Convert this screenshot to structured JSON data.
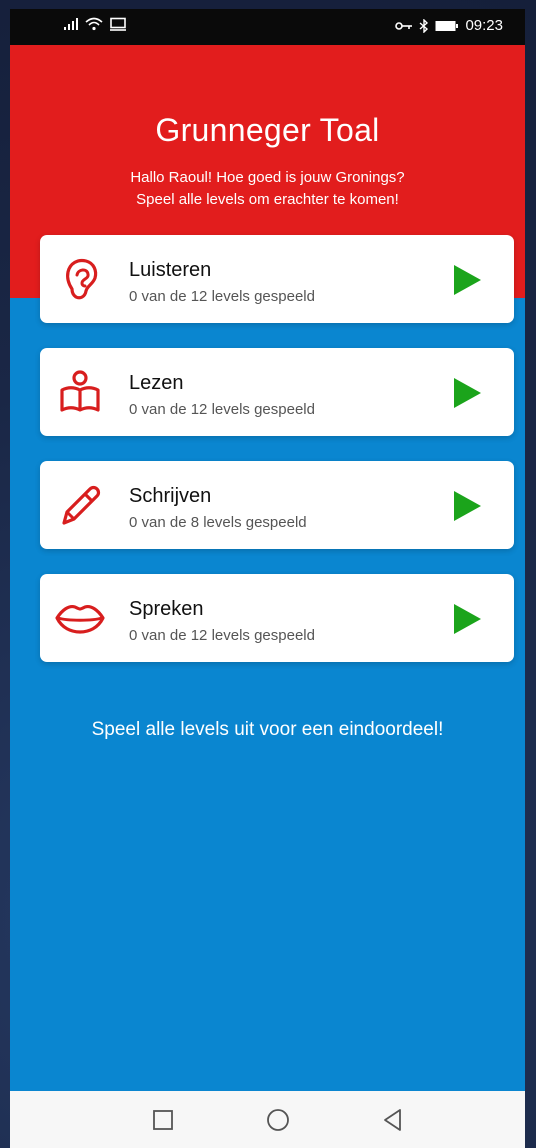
{
  "status_bar": {
    "time": "09:23"
  },
  "header": {
    "title": "Grunneger Toal",
    "intro_line1": "Hallo Raoul! Hoe goed is jouw Gronings?",
    "intro_line2": "Speel alle levels om erachter te komen!"
  },
  "cards": [
    {
      "title": "Luisteren",
      "subtitle": "0 van de 12 levels gespeeld",
      "icon": "ear-icon"
    },
    {
      "title": "Lezen",
      "subtitle": "0 van de 12 levels gespeeld",
      "icon": "reading-person-icon"
    },
    {
      "title": "Schrijven",
      "subtitle": "0 van de 8 levels gespeeld",
      "icon": "pencil-icon"
    },
    {
      "title": "Spreken",
      "subtitle": "0 van de 12 levels gespeeld",
      "icon": "lips-icon"
    }
  ],
  "footer": {
    "text": "Speel alle levels uit voor een eindoordeel!"
  },
  "colors": {
    "header_red": "#e21d1d",
    "background_blue": "#0a86d0",
    "play_green": "#1ba41b",
    "icon_red": "#d81e1e"
  }
}
